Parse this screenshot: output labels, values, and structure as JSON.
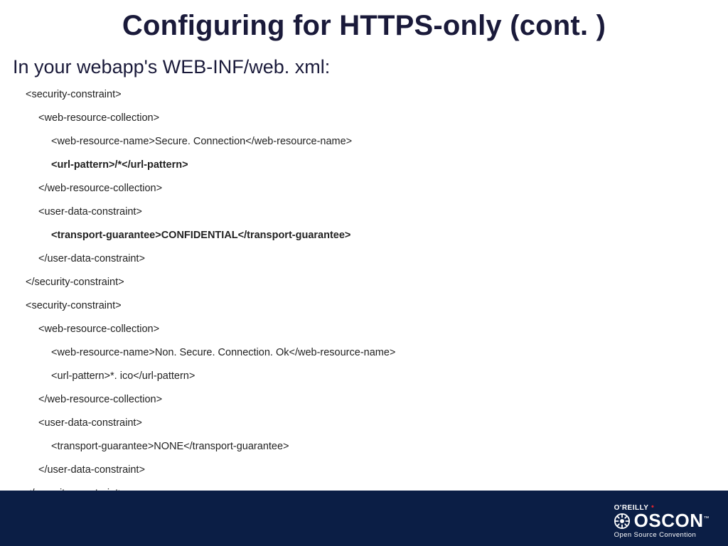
{
  "title": "Configuring for HTTPS-only (cont. )",
  "subtitle": "In your webapp's WEB-INF/web. xml:",
  "code": {
    "l1": "<security-constraint>",
    "l2": "<web-resource-collection>",
    "l3": "<web-resource-name>Secure. Connection</web-resource-name>",
    "l4": "<url-pattern>/*</url-pattern>",
    "l5": "</web-resource-collection>",
    "l6": "<user-data-constraint>",
    "l7": "<transport-guarantee>CONFIDENTIAL</transport-guarantee>",
    "l8": "</user-data-constraint>",
    "l9": "</security-constraint>",
    "l10": "<security-constraint>",
    "l11": "<web-resource-collection>",
    "l12": "<web-resource-name>Non. Secure. Connection. Ok</web-resource-name>",
    "l13": "<url-pattern>*. ico</url-pattern>",
    "l14": "</web-resource-collection>",
    "l15": "<user-data-constraint>",
    "l16": "<transport-guarantee>NONE</transport-guarantee>",
    "l17": "</user-data-constraint>",
    "l18": "</security-constraint>"
  },
  "footer": {
    "brand": "O'REILLY",
    "logo": "OSCON",
    "tagline": "Open Source Convention"
  }
}
